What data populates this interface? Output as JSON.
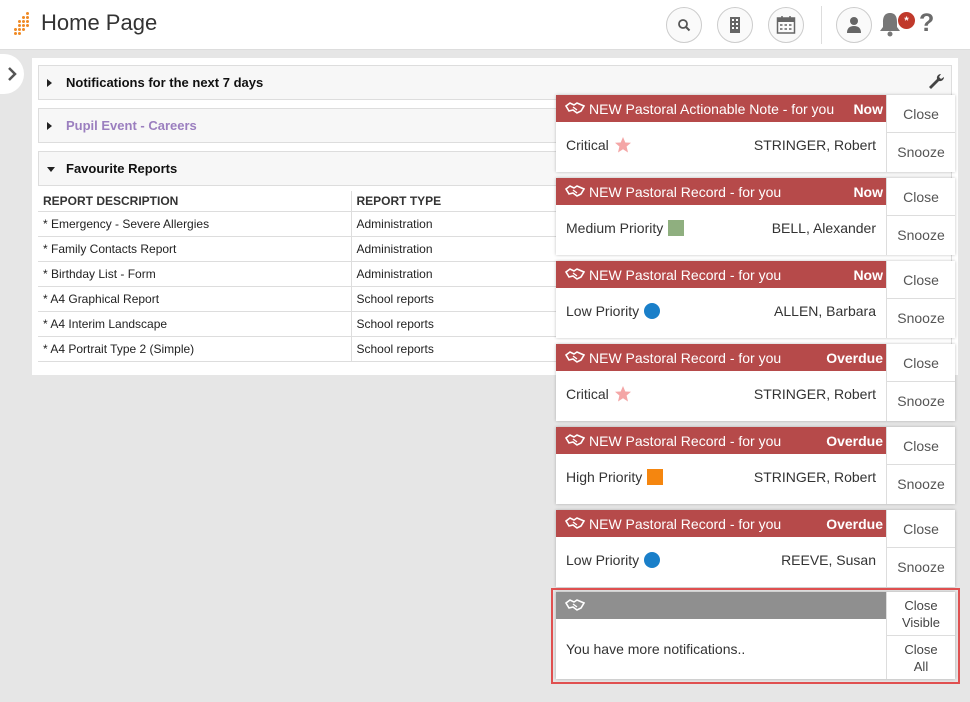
{
  "header": {
    "title": "Home Page",
    "icons": [
      "search-icon",
      "building-icon",
      "calendar-icon",
      "user-icon",
      "bell-icon",
      "help-icon"
    ],
    "badge": "*",
    "help": "?"
  },
  "sections": [
    {
      "title": "Notifications for the next 7 days",
      "expanded": false
    },
    {
      "title": "Pupil Event - Careers",
      "expanded": false,
      "color": "#9b7fbf"
    },
    {
      "title": "Favourite Reports",
      "expanded": true
    }
  ],
  "reports": {
    "columns": [
      "REPORT DESCRIPTION",
      "REPORT TYPE"
    ],
    "rows": [
      [
        "* Emergency - Severe Allergies",
        "Administration"
      ],
      [
        "* Family Contacts Report",
        "Administration"
      ],
      [
        "* Birthday List - Form",
        "Administration"
      ],
      [
        "* A4 Graphical Report",
        "School reports"
      ],
      [
        "* A4 Interim Landscape",
        "School reports"
      ],
      [
        "* A4 Portrait Type 2 (Simple)",
        "School reports"
      ]
    ]
  },
  "notifications": [
    {
      "title": "NEW Pastoral Actionable Note - for you",
      "status": "Now",
      "priority": "Critical",
      "name": "STRINGER, Robert",
      "close": "Close",
      "snooze": "Snooze"
    },
    {
      "title": "NEW Pastoral Record - for you",
      "status": "Now",
      "priority": "Medium Priority",
      "name": "BELL, Alexander",
      "close": "Close",
      "snooze": "Snooze"
    },
    {
      "title": "NEW Pastoral Record - for you",
      "status": "Now",
      "priority": "Low Priority",
      "name": "ALLEN, Barbara",
      "close": "Close",
      "snooze": "Snooze"
    },
    {
      "title": "NEW Pastoral Record - for you",
      "status": "Overdue",
      "priority": "Critical",
      "name": "STRINGER, Robert",
      "close": "Close",
      "snooze": "Snooze"
    },
    {
      "title": "NEW Pastoral Record - for you",
      "status": "Overdue",
      "priority": "High Priority",
      "name": "STRINGER, Robert",
      "close": "Close",
      "snooze": "Snooze"
    },
    {
      "title": "NEW Pastoral Record - for you",
      "status": "Overdue",
      "priority": "Low Priority",
      "name": "REEVE, Susan",
      "close": "Close",
      "snooze": "Snooze"
    }
  ],
  "priority_colors": {
    "Critical": "#f4a6a6",
    "Medium Priority": "#8faf7f",
    "Low Priority": "#1a7fc9",
    "High Priority": "#f5860f"
  },
  "more": {
    "text": "You have more notifications..",
    "close_visible_1": "Close",
    "close_visible_2": "Visible",
    "close_all_1": "Close",
    "close_all_2": "All"
  },
  "colors": {
    "notification_header": "#b64a4a",
    "more_header": "#8f8f8f",
    "logo": "#f08a24"
  }
}
